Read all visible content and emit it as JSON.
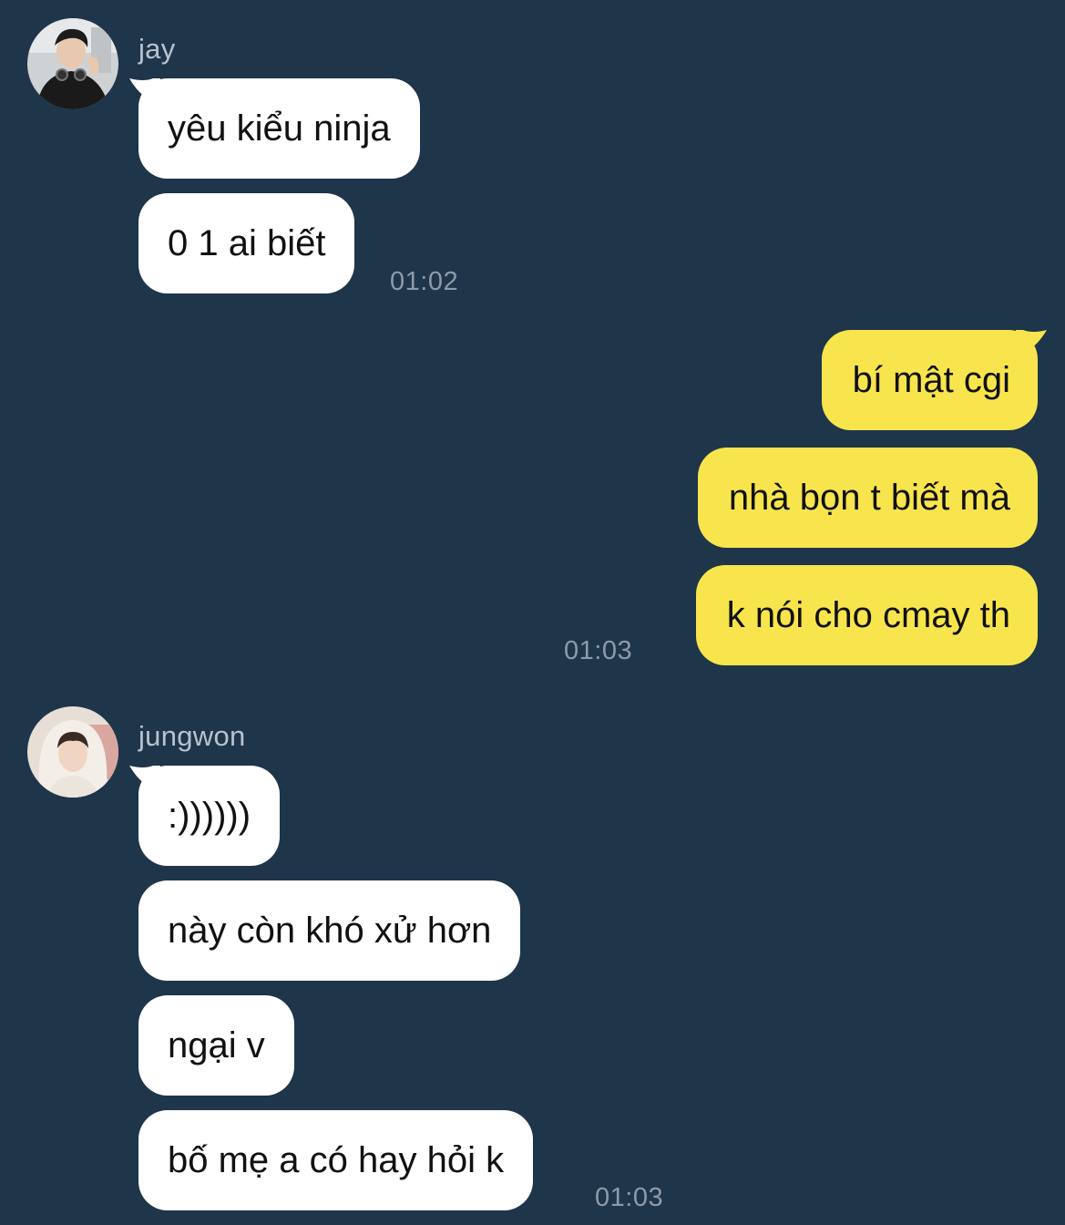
{
  "colors": {
    "background": "#1e354a",
    "incoming_bubble": "#ffffff",
    "outgoing_bubble": "#f8e54d",
    "sender_name": "#b6c3cf",
    "timestamp": "#8d9ba8"
  },
  "groups": [
    {
      "sender": "jay",
      "avatar_icon": "profile-photo-icon",
      "messages": [
        "yêu kiểu ninja",
        "0 1 ai biết"
      ],
      "time": "01:02"
    },
    {
      "sender": "me",
      "messages": [
        "bí mật cgi",
        "nhà bọn t biết mà",
        "k nói cho cmay th"
      ],
      "time": "01:03"
    },
    {
      "sender": "jungwon",
      "avatar_icon": "profile-photo-icon",
      "messages": [
        ":))))))",
        "này còn khó xử hơn",
        "ngại v",
        "bố mẹ a có hay hỏi k"
      ],
      "time": "01:03"
    }
  ]
}
